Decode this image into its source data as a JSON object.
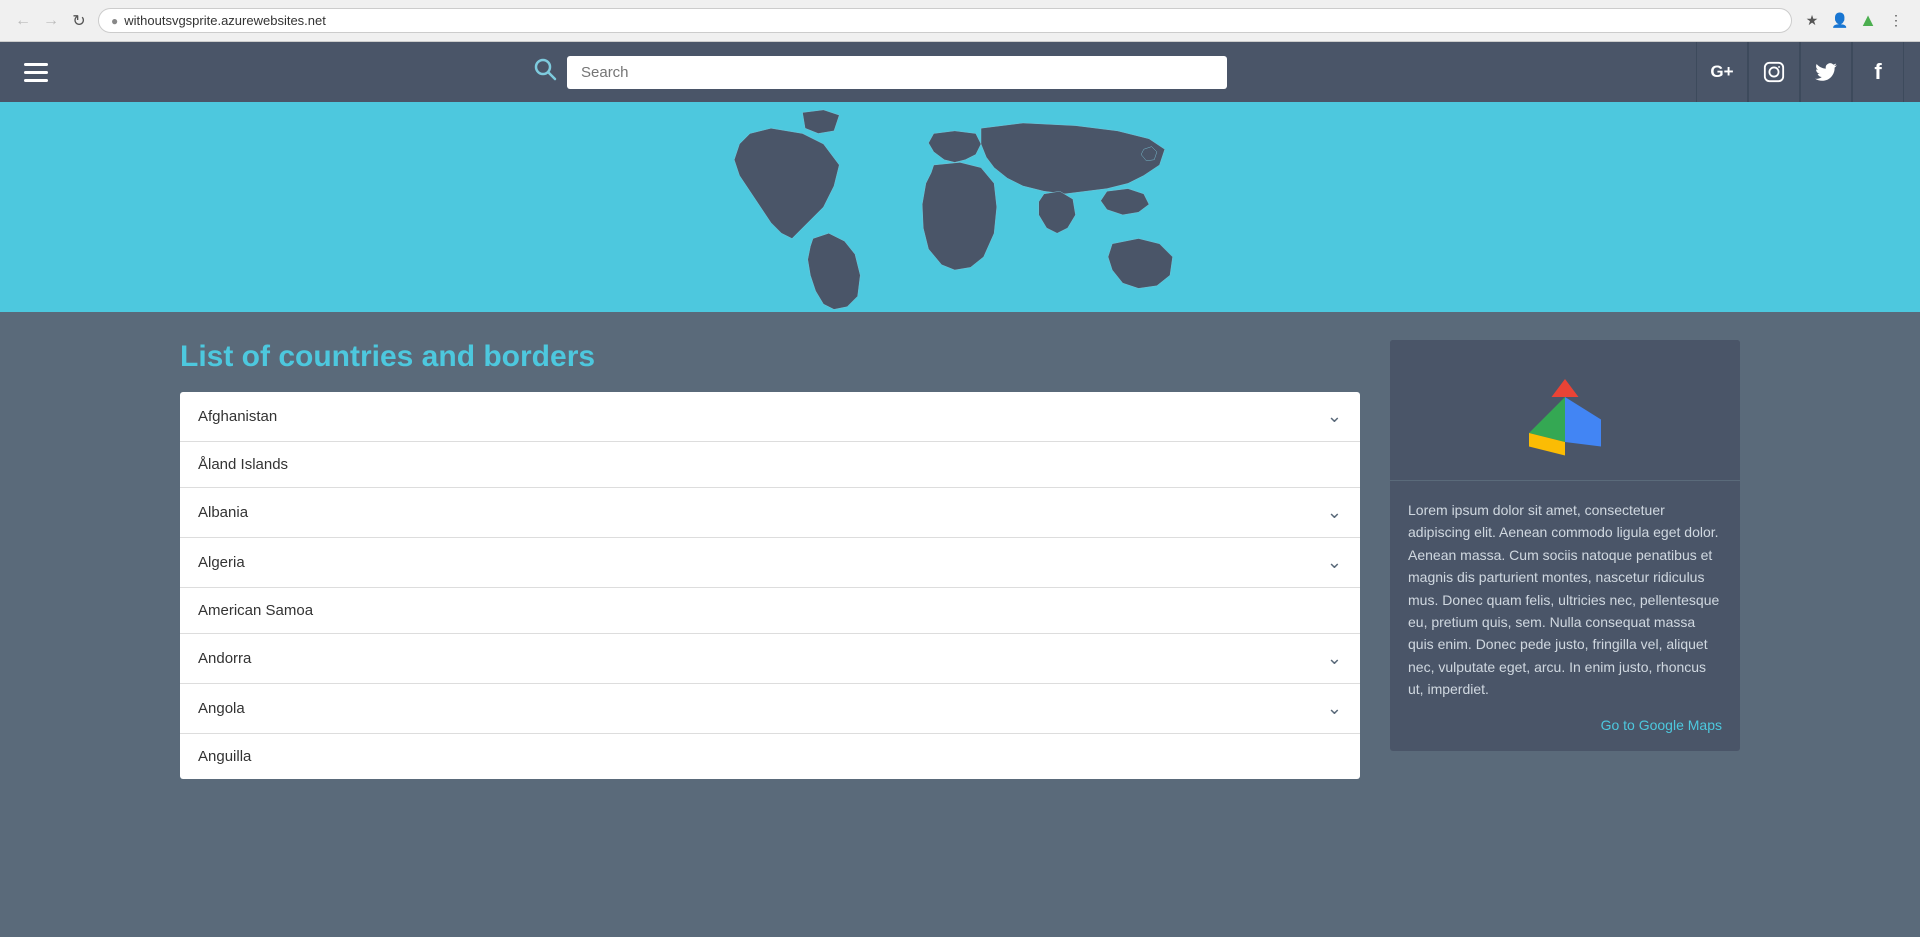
{
  "browser": {
    "url": "withoutsvgsprite.azurewebsites.net",
    "back_disabled": true,
    "forward_disabled": true
  },
  "navbar": {
    "search_placeholder": "Search",
    "social": [
      {
        "name": "google-plus",
        "label": "G+"
      },
      {
        "name": "instagram",
        "label": "📷"
      },
      {
        "name": "twitter",
        "label": "🐦"
      },
      {
        "name": "facebook",
        "label": "f"
      }
    ]
  },
  "hero": {
    "alt": "World map"
  },
  "section": {
    "title": "List of countries and borders"
  },
  "countries": [
    {
      "name": "Afghanistan",
      "has_dropdown": true
    },
    {
      "name": "Åland Islands",
      "has_dropdown": false
    },
    {
      "name": "Albania",
      "has_dropdown": true
    },
    {
      "name": "Algeria",
      "has_dropdown": true
    },
    {
      "name": "American Samoa",
      "has_dropdown": false
    },
    {
      "name": "Andorra",
      "has_dropdown": true
    },
    {
      "name": "Angola",
      "has_dropdown": true
    },
    {
      "name": "Anguilla",
      "has_dropdown": false
    }
  ],
  "sidebar": {
    "description": "Lorem ipsum dolor sit amet, consectetuer adipiscing elit. Aenean commodo ligula eget dolor. Aenean massa. Cum sociis natoque penatibus et magnis dis parturient montes, nascetur ridiculus mus. Donec quam felis, ultricies nec, pellentesque eu, pretium quis, sem. Nulla consequat massa quis enim. Donec pede justo, fringilla vel, aliquet nec, vulputate eget, arcu. In enim justo, rhoncus ut, imperdiet.",
    "go_to_maps_label": "Go to Google Maps",
    "go_to_maps_url": "https://maps.google.com"
  },
  "colors": {
    "accent": "#4dc8de",
    "nav_bg": "#4a5568",
    "body_bg": "#5a6a7a",
    "hero_bg": "#4dc8de"
  }
}
